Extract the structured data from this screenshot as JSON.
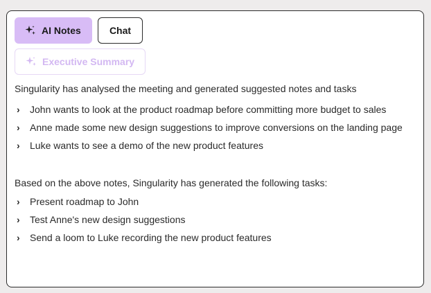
{
  "tabs": {
    "ai_notes_label": "AI Notes",
    "chat_label": "Chat"
  },
  "executive_summary": {
    "label": "Executive Summary"
  },
  "notes": {
    "intro": "Singularity has analysed the meeting and generated suggested notes and tasks",
    "items": [
      "John wants to look at the product roadmap before committing more budget to sales",
      "Anne made some new design suggestions to improve conversions on the landing page",
      "Luke wants to see a demo of the new product features"
    ]
  },
  "tasks": {
    "intro": "Based on the above notes, Singularity has generated the following tasks:",
    "items": [
      "Present roadmap to John",
      "Test Anne's new design suggestions",
      "Send a loom to Luke recording the new product features"
    ]
  },
  "icons": {
    "bullet": "chevron-right-icon",
    "sparkle": "sparkle-icon"
  },
  "colors": {
    "accent": "#d8bcf6",
    "accent_muted": "#d3b8f2",
    "border": "#2b2b2b"
  }
}
